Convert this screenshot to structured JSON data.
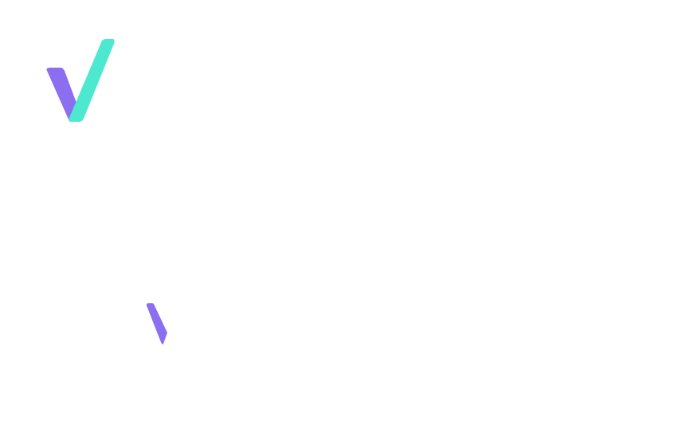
{
  "logo": {
    "icon": "checkmark-logo-icon",
    "colors": {
      "left_stroke": "#8c6ef0",
      "right_stroke": "#4de8d0"
    }
  },
  "fragment": {
    "icon": "checkmark-fragment-icon",
    "colors": {
      "stroke": "#8c6ef0"
    }
  }
}
